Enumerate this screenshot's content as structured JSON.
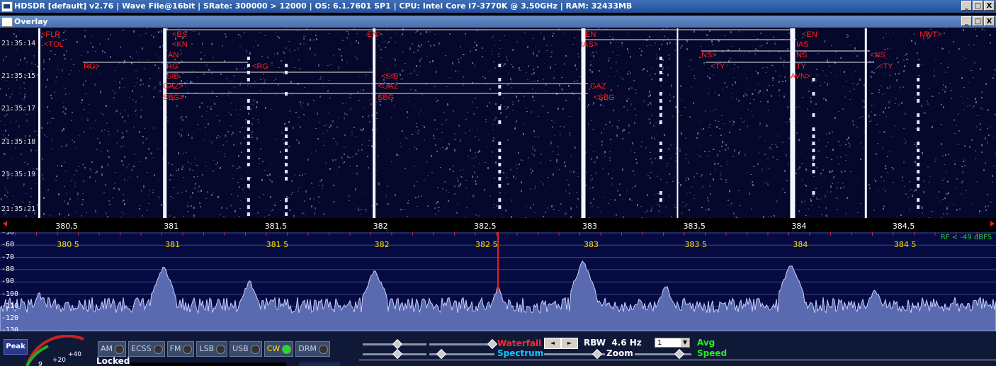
{
  "window": {
    "title": "HDSDR  [default]  v2.76   |  Wave File@16bit   |  SRate: 300000 > 12000   |  OS: 6.1.7601 SP1   |  CPU: Intel Core i7-3770K @ 3.50GHz   |  RAM: 32433MB",
    "minimize": "_",
    "maximize": "□",
    "close": "X"
  },
  "overlay": {
    "title": "Overlay",
    "minimize": "_",
    "maximize": "□",
    "close": "X"
  },
  "waterfall": {
    "timestamps": [
      "21:35:14",
      "21:35:15",
      "21:35:17",
      "21:35:18",
      "21:35:19",
      "21:35:21"
    ],
    "callsign_labels": [
      "<FLR",
      "<TOL",
      "<ES",
      "<KN",
      "AN",
      "RG>",
      "RG",
      "<RG",
      "SIB",
      "<SIB",
      "GAZ>",
      "GAZ",
      "<GAZ",
      "SBG>",
      "SBG",
      "<SBG",
      "EN>",
      "EN",
      "IAS>",
      "<EN",
      "IAS",
      "NS>",
      "NS",
      "<NS",
      "<TY",
      "TY",
      "<TY",
      "AVN>",
      "NWT>"
    ]
  },
  "freq_axis": {
    "labels": [
      "380,5",
      "381",
      "381,5",
      "382",
      "382,5",
      "383",
      "383,5",
      "384",
      "384,5"
    ]
  },
  "spectrum": {
    "db_labels": [
      "-50",
      "-60",
      "-70",
      "-80",
      "-90",
      "-100",
      "-110",
      "-120",
      "-130"
    ],
    "freq_labels": [
      "380 5",
      "381",
      "381 5",
      "382",
      "382 5",
      "383",
      "383 5",
      "384",
      "384 5"
    ],
    "rf_level": "RF < -49 dBFS"
  },
  "controls": {
    "peak": "Peak",
    "smeter_scale": [
      "+20",
      "+40",
      "9"
    ],
    "locked": "Locked",
    "modes": [
      "AM",
      "ECSS",
      "FM",
      "LSB",
      "USB",
      "CW",
      "DRM"
    ],
    "active_mode": "CW",
    "waterfall_label": "Waterfall",
    "spectrum_label": "Spectrum",
    "rbw_label": "RBW",
    "rbw_value": "4.6 Hz",
    "zoom_label": "Zoom",
    "avg_value": "1",
    "avg_label": "Avg",
    "speed_label": "Speed",
    "arrow_left": "◄",
    "arrow_right": "►"
  },
  "colors": {
    "waterfall_bg": "#05082a",
    "spectrum_bg": "#050a40",
    "spectrum_fill": "#6a7ac0",
    "label_red": "#ff2020",
    "freq_yellow": "#ffe000",
    "rf_green": "#2ecc2e"
  }
}
